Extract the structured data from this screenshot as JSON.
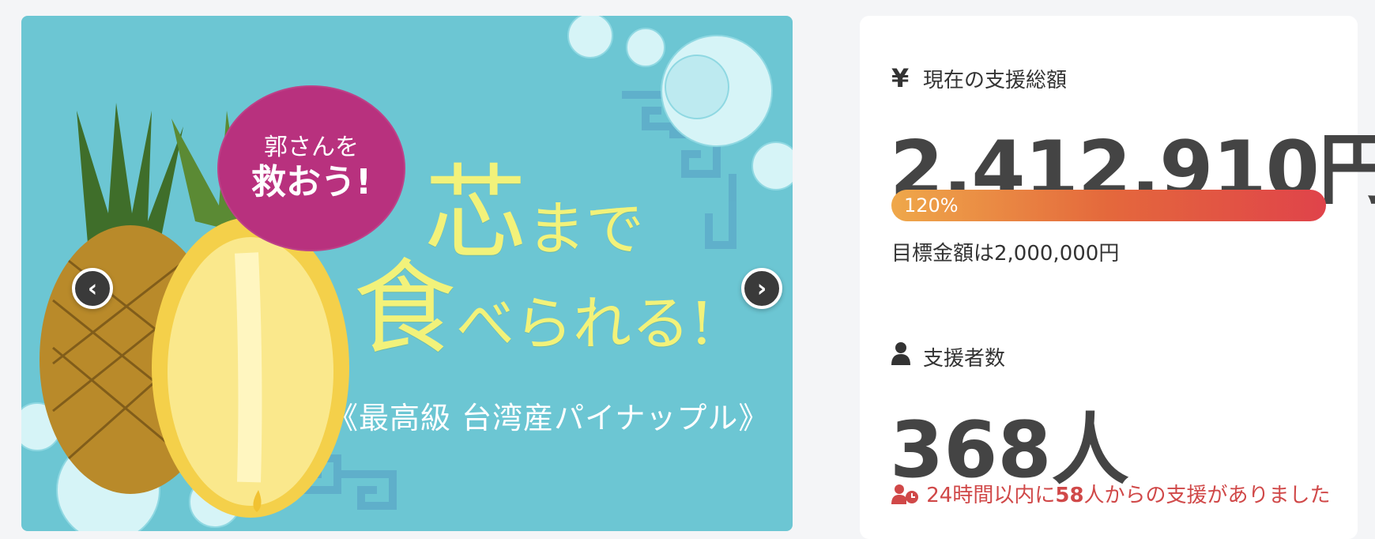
{
  "banner": {
    "badge_line1": "郭さんを",
    "badge_line2": "救おう!",
    "headline_big1": "芯",
    "headline_small1": "まで",
    "headline_big2": "食",
    "headline_small2": "べられる!",
    "subline": "《最高級 台湾産パイナップル》",
    "prev_icon": "chevron-left",
    "next_icon": "chevron-right",
    "colors": {
      "background": "#6cc6d3",
      "badge": "#b8317e",
      "headline": "#f2f27a"
    }
  },
  "stats": {
    "total_label": "現在の支援総額",
    "total_icon": "yen-icon",
    "total_amount": "2,412,910円",
    "progress_percent": 120,
    "progress_text": "120%",
    "goal_text": "目標金額は2,000,000円",
    "backers_label": "支援者数",
    "backers_icon": "user-icon",
    "backers_count": "368人",
    "recent_prefix": "24時間以内に",
    "recent_count": "58",
    "recent_suffix": "人からの支援がありました",
    "colors": {
      "accent_start": "#efa84a",
      "accent_end": "#e0434a",
      "recent_text": "#d04848"
    }
  }
}
